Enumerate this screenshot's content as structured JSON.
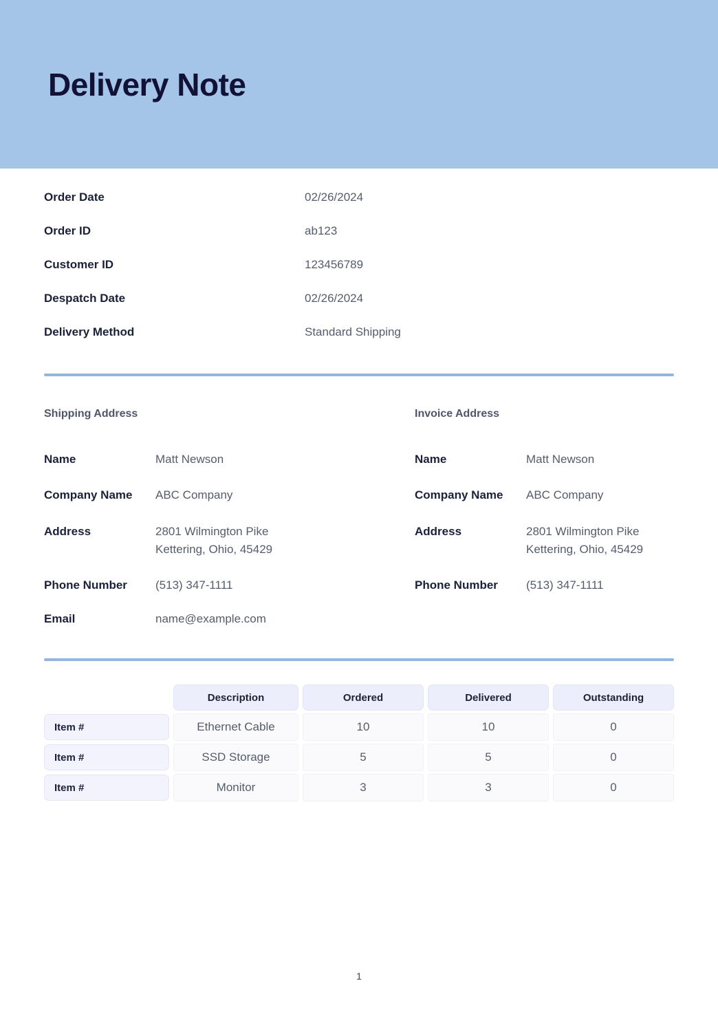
{
  "document": {
    "title": "Delivery Note",
    "page_number": "1",
    "colors": {
      "banner_background": "#a4c4e8",
      "title_text": "#111236",
      "divider": "#92b6e0",
      "table_header_background": "#eceefb",
      "item_cell_background": "#f2f3fc",
      "body_cell_background": "#fafafc"
    }
  },
  "summary": {
    "rows": [
      {
        "label": "Order Date",
        "value": "02/26/2024"
      },
      {
        "label": "Order ID",
        "value": "ab123"
      },
      {
        "label": "Customer ID",
        "value": "123456789"
      },
      {
        "label": "Despatch Date",
        "value": "02/26/2024"
      },
      {
        "label": "Delivery Method",
        "value": "Standard Shipping"
      }
    ]
  },
  "shipping_address": {
    "heading": "Shipping Address",
    "rows": [
      {
        "label": "Name",
        "value": "Matt Newson"
      },
      {
        "label": "Company Name",
        "value": "ABC Company"
      },
      {
        "label": "Address",
        "value": "2801 Wilmington Pike\nKettering, Ohio, 45429"
      },
      {
        "label": "Phone Number",
        "value": "(513) 347-1111"
      },
      {
        "label": "Email",
        "value": "name@example.com"
      }
    ]
  },
  "invoice_address": {
    "heading": "Invoice Address",
    "rows": [
      {
        "label": "Name",
        "value": "Matt Newson"
      },
      {
        "label": "Company Name",
        "value": "ABC Company"
      },
      {
        "label": "Address",
        "value": "2801 Wilmington Pike\nKettering, Ohio, 45429"
      },
      {
        "label": "Phone Number",
        "value": "(513) 347-1111"
      }
    ]
  },
  "items_table": {
    "headers": [
      "",
      "Description",
      "Ordered",
      "Delivered",
      "Outstanding"
    ],
    "rows": [
      {
        "item": "Item #",
        "description": "Ethernet Cable",
        "ordered": "10",
        "delivered": "10",
        "outstanding": "0"
      },
      {
        "item": "Item #",
        "description": "SSD Storage",
        "ordered": "5",
        "delivered": "5",
        "outstanding": "0"
      },
      {
        "item": "Item #",
        "description": "Monitor",
        "ordered": "3",
        "delivered": "3",
        "outstanding": "0"
      }
    ]
  }
}
